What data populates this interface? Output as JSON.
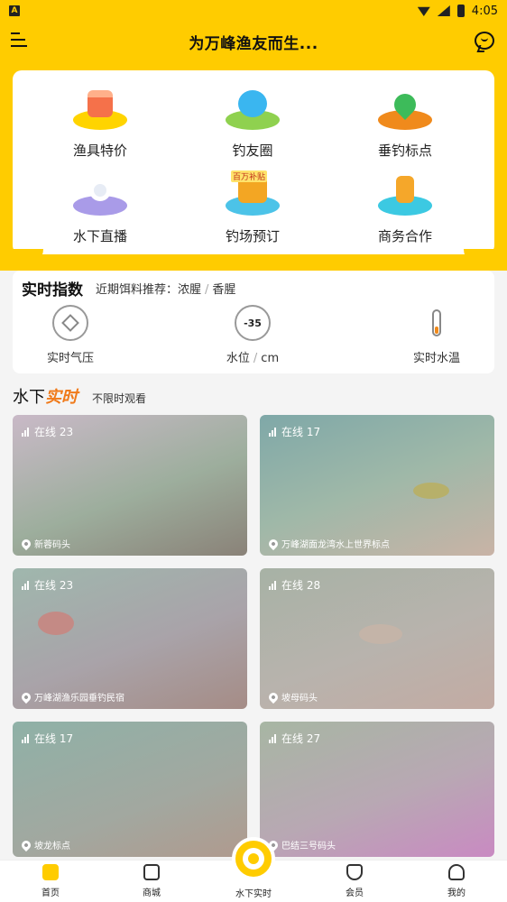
{
  "status": {
    "time": "4:05",
    "left_badge": "A"
  },
  "header": {
    "title": "为万峰渔友而生..."
  },
  "grid": [
    {
      "label": "渔具特价",
      "icon": "tackle-sale-icon"
    },
    {
      "label": "钓友圈",
      "icon": "angler-circle-icon"
    },
    {
      "label": "垂钓标点",
      "icon": "fishing-spot-icon"
    },
    {
      "label": "水下直播",
      "icon": "underwater-live-icon"
    },
    {
      "label": "钓场预订",
      "icon": "booking-icon",
      "badge": "百万补贴"
    },
    {
      "label": "商务合作",
      "icon": "business-icon"
    }
  ],
  "index": {
    "title": "实时指数",
    "sub_prefix": "近期饵料推荐：",
    "bait_a": "浓腥",
    "bait_sep": "/",
    "bait_b": "香腥",
    "pressure_label": "实时气压",
    "water_value": "-35",
    "water_label": "水位",
    "water_sep": "/",
    "water_unit": "cm",
    "temp_label": "实时水温"
  },
  "section": {
    "title_a": "水下",
    "title_b": "实时",
    "note": "不限时观看"
  },
  "videos": [
    {
      "online": "在线 23",
      "location": "新蓉码头"
    },
    {
      "online": "在线 17",
      "location": "万峰湖面龙湾水上世界标点"
    },
    {
      "online": "在线 23",
      "location": "万峰湖渔乐园垂钓民宿"
    },
    {
      "online": "在线 28",
      "location": "坡母码头"
    },
    {
      "online": "在线 17",
      "location": "坡龙标点"
    },
    {
      "online": "在线 27",
      "location": "巴结三号码头"
    }
  ],
  "tabs": [
    {
      "label": "首页"
    },
    {
      "label": "商城"
    },
    {
      "label": "水下实时"
    },
    {
      "label": "会员"
    },
    {
      "label": "我的"
    }
  ],
  "colors": {
    "brand": "#ffcc00",
    "accent": "#f07a1a"
  }
}
